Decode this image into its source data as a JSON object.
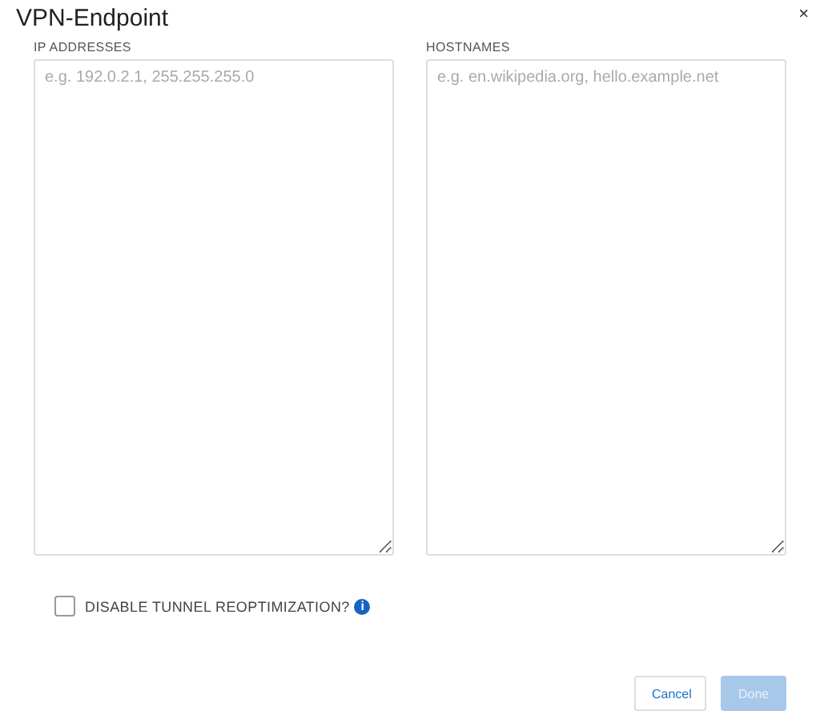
{
  "window": {
    "title": "VPN-Endpoint",
    "close": "×"
  },
  "fields": [
    {
      "label": "IP ADDRESSES",
      "placeholder": "e.g. 192.0.2.1, 255.255.255.0"
    },
    {
      "label": "HOSTNAMES",
      "placeholder": "e.g. en.wikipedia.org, hello.example.net"
    }
  ],
  "option": {
    "label": "DISABLE TUNNEL REOPTIMIZATION?",
    "checked": false,
    "info": "i"
  },
  "buttons": [
    {
      "label": "Cancel",
      "kind": "secondary",
      "disabled": false
    },
    {
      "label": "Done",
      "kind": "primary",
      "disabled": true
    }
  ]
}
